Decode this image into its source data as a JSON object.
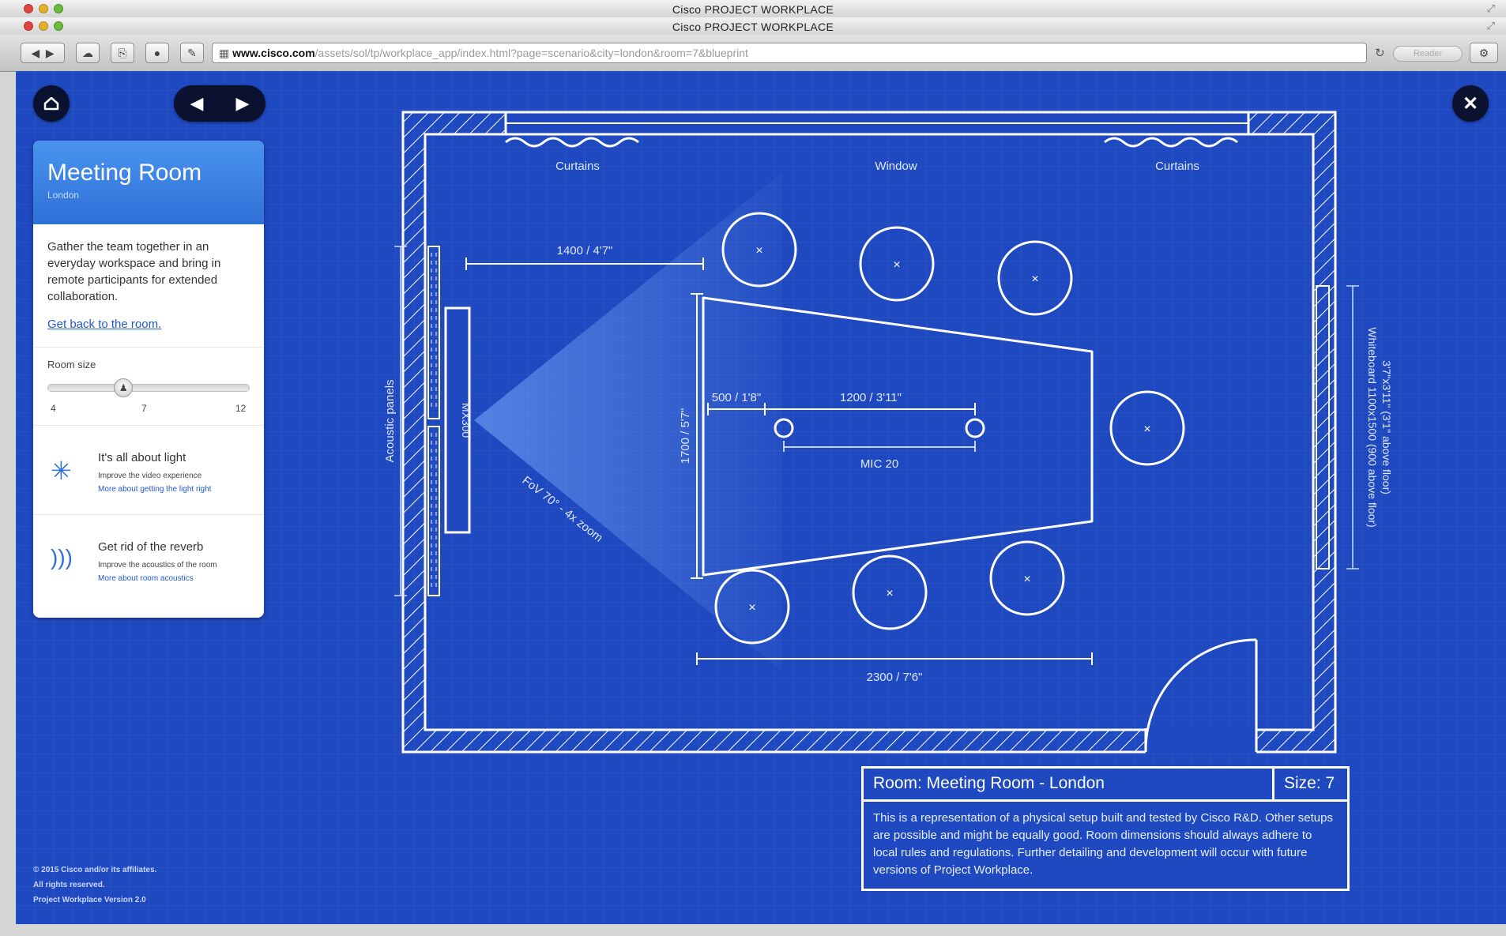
{
  "window": {
    "title": "Cisco PROJECT WORKPLACE",
    "url_domain": "www.cisco.com",
    "url_path": "/assets/sol/tp/workplace_app/index.html?page=scenario&city=london&room=7&blueprint",
    "reader_label": "Reader"
  },
  "nav": {
    "home_icon": "home-icon",
    "back_icon": "arrow-left-icon",
    "forward_icon": "arrow-right-icon",
    "close_icon": "close-icon"
  },
  "card": {
    "title": "Meeting Room",
    "subtitle": "London",
    "description": "Gather the team together in an everyday workspace and bring in remote participants for extended collaboration.",
    "link": "Get back to the room.",
    "slider": {
      "label": "Room size",
      "min": "4",
      "value": "7",
      "max": "12",
      "fraction": 0.375
    },
    "tips": [
      {
        "icon": "light-icon",
        "title": "It's all about light",
        "text": "Improve the video experience",
        "link": "More about getting the light right"
      },
      {
        "icon": "sound-icon",
        "title": "Get rid of the reverb",
        "text": "Improve the acoustics of the room",
        "link": "More about room acoustics"
      }
    ]
  },
  "footer": {
    "line1": "© 2015 Cisco and/or its affiliates.",
    "line2": "All rights reserved.",
    "line3": "Project Workplace Version 2.0"
  },
  "plan": {
    "labels": {
      "curtains_left": "Curtains",
      "window": "Window",
      "curtains_right": "Curtains",
      "dim_1400": "1400 / 4'7\"",
      "dim_500": "500 / 1'8\"",
      "dim_1200": "1200 / 3'11\"",
      "dim_1700": "1700 / 5'7\"",
      "mic": "MIC 20",
      "dim_2300": "2300 / 7'6\"",
      "acoustic": "Acoustic panels",
      "codec": "MX300",
      "fov": "FoV 70° - 4x zoom",
      "whiteboard1": "Whiteboard 1100x1500 (900 above floor)",
      "whiteboard2": "3'7\"x3'11\" (3'1\" above floor)"
    }
  },
  "info": {
    "room": "Room: Meeting Room - London",
    "size": "Size: 7",
    "text": "This is a representation of a physical setup built and tested by Cisco R&D. Other setups are possible and might be equally good. Room dimensions should always adhere to local rules and regulations. Further detailing and development will occur with future versions of Project Workplace."
  }
}
